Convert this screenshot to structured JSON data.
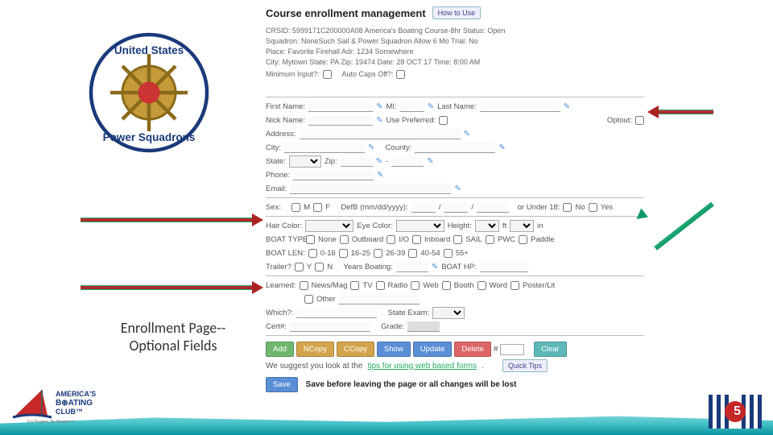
{
  "title": "Course enrollment management",
  "how_to_use": "How to Use",
  "info": {
    "line1": "CRSID: 5999171C200000A08   America's Boating Course-8hr   Status: Open",
    "line2": "Squadron: NoneSuch Sail & Power Squadron    Allow 6 Mo Trial: No",
    "line3": "Place: Favorite Firehall   Adr: 1234 Somewhere",
    "line4": "City: Mytown   State: PA   Zip: 19474    Date: 28 OCT 17   Time: 8:00 AM",
    "line5_a": "Minimum Input?:",
    "line5_b": "Auto Caps Off?:"
  },
  "form": {
    "first_name": "First Name:",
    "mi": "MI:",
    "last_name": "Last Name:",
    "nick_name": "Nick Name:",
    "use_preferred": "Use Preferred:",
    "optout": "Optout:",
    "address": "Address:",
    "city": "City:",
    "county": "County:",
    "state": "State:",
    "zip": "Zip:",
    "phone": "Phone:",
    "email": "Email:",
    "sex": "Sex:",
    "m": "M",
    "f": "F",
    "defb": "DefB (mm/dd/yyyy):",
    "under18": "or Under 18:",
    "no": "No",
    "yes": "Yes",
    "hair": "Hair Color:",
    "eye": "Eye Color:",
    "height": "Height:",
    "ft": "ft",
    "in": "in",
    "boattype": "BOAT TYPE:",
    "none": "None",
    "outboard": "Outboard",
    "io": "I/O",
    "inboard": "Inboard",
    "sail": "SAIL",
    "pwc": "PWC",
    "paddle": "Paddle",
    "boatlen": "BOAT LEN:",
    "l1": "0-16",
    "l2": "16-25",
    "l3": "26-39",
    "l4": "40-54",
    "l5": "55+",
    "trailer": "Trailer?",
    "y": "Y",
    "n": "N",
    "years": "Years Boating:",
    "hp": "BOAT HP:",
    "learned": "Learned:",
    "news": "News/Mag",
    "tv": "TV",
    "radio": "Radio",
    "web": "Web",
    "booth": "Booth",
    "word": "Word",
    "poster": "Poster/Lit",
    "oth": "Other",
    "which": "Which?:",
    "stateexam": "State Exam:",
    "cert": "Cert#:",
    "grade": "Grade:"
  },
  "buttons": {
    "add": "Add",
    "ncopy": "NCopy",
    "ccopy": "CCopy",
    "show": "Show",
    "update": "Update",
    "delete": "Delete",
    "hash": "#",
    "clear": "Clear",
    "quicktips": "Quick Tips",
    "save": "Save"
  },
  "suggest_a": "We suggest you look at the ",
  "suggest_link": "tips for using web based forms",
  "suggest_b": ".",
  "save_msg": "Save before leaving the page or all changes will be lost",
  "caption_a": "Enrollment Page--",
  "caption_b": "Optional Fields",
  "pagenum": "5"
}
